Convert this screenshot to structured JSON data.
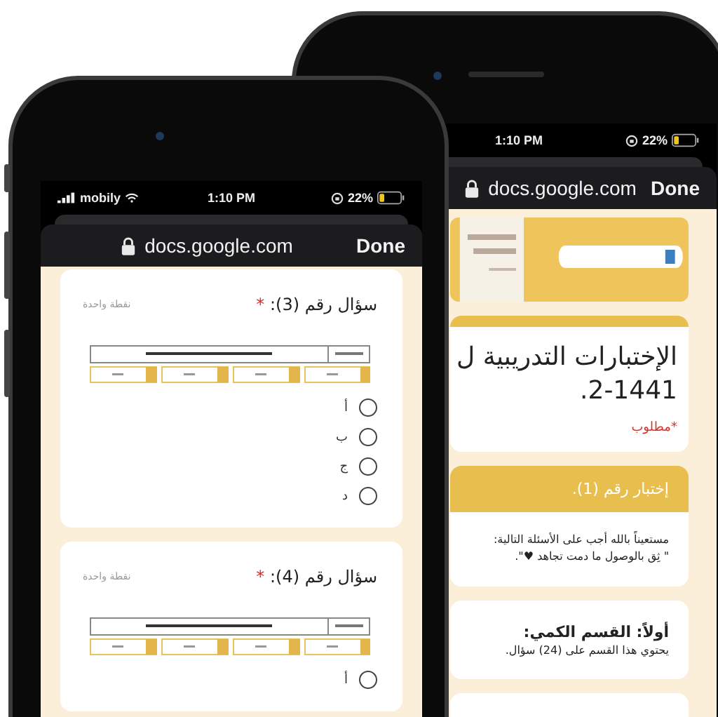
{
  "back_phone": {
    "status_bar": {
      "time": "1:10 PM",
      "battery": "22%"
    },
    "browser_bar": {
      "url": "docs.google.com",
      "done": "Done"
    },
    "form": {
      "title_lines": [
        "الإختبارات التدريبية ل",
        ".2-1441"
      ],
      "required_note": "*مطلوب",
      "section_title": "إختبار رقم (1).",
      "intro_lines": [
        "مستعيناً بالله أجب على الأسئلة التالية:",
        "\" ثِق بالوصول ما دمت تجاهد ♥\"."
      ],
      "part": {
        "title": "أولاً: القسم الكمي:",
        "description": "يحتوي هذا القسم على (24) سؤال."
      }
    }
  },
  "front_phone": {
    "status_bar": {
      "carrier": "mobily",
      "time": "1:10 PM",
      "battery": "22%"
    },
    "browser_bar": {
      "url": "docs.google.com",
      "done": "Done"
    },
    "questions": [
      {
        "title": "سؤال رقم (3):",
        "required_mark": "*",
        "points": "نقطة واحدة",
        "options": [
          {
            "label": "أ",
            "selected": false
          },
          {
            "label": "ب",
            "selected": false
          },
          {
            "label": "ج",
            "selected": false
          },
          {
            "label": "د",
            "selected": false
          }
        ]
      },
      {
        "title": "سؤال رقم (4):",
        "required_mark": "*",
        "points": "نقطة واحدة",
        "options": [
          {
            "label": "أ",
            "selected": false
          }
        ]
      }
    ]
  }
}
